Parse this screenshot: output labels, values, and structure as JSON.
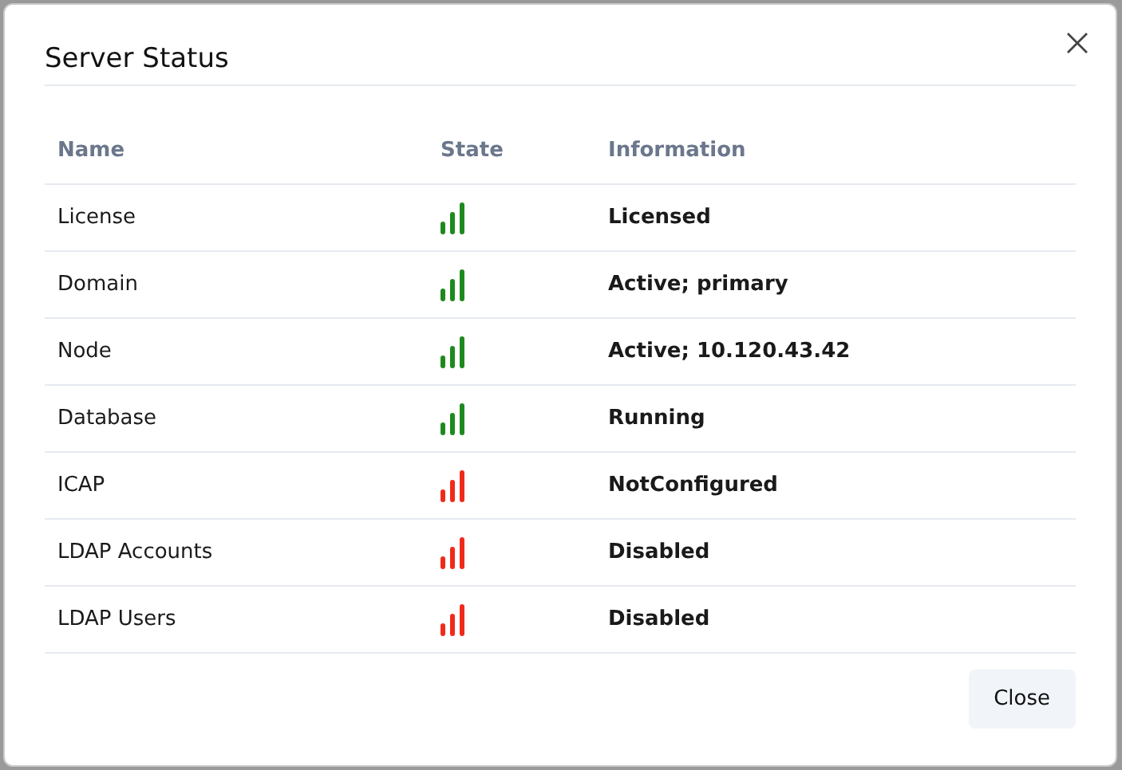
{
  "dialog": {
    "title": "Server Status"
  },
  "table": {
    "columns": [
      "Name",
      "State",
      "Information"
    ],
    "rows": [
      {
        "name": "License",
        "color": "#1e8a1e",
        "information": "Licensed"
      },
      {
        "name": "Domain",
        "color": "#1e8a1e",
        "information": "Active; primary"
      },
      {
        "name": "Node",
        "color": "#1e8a1e",
        "information": "Active; 10.120.43.42"
      },
      {
        "name": "Database",
        "color": "#1e8a1e",
        "information": "Running"
      },
      {
        "name": "ICAP",
        "color": "#f02a1a",
        "information": "NotConfigured"
      },
      {
        "name": "LDAP Accounts",
        "color": "#f02a1a",
        "information": "Disabled"
      },
      {
        "name": "LDAP Users",
        "color": "#f02a1a",
        "information": "Disabled"
      }
    ]
  },
  "buttons": [
    "Close"
  ]
}
